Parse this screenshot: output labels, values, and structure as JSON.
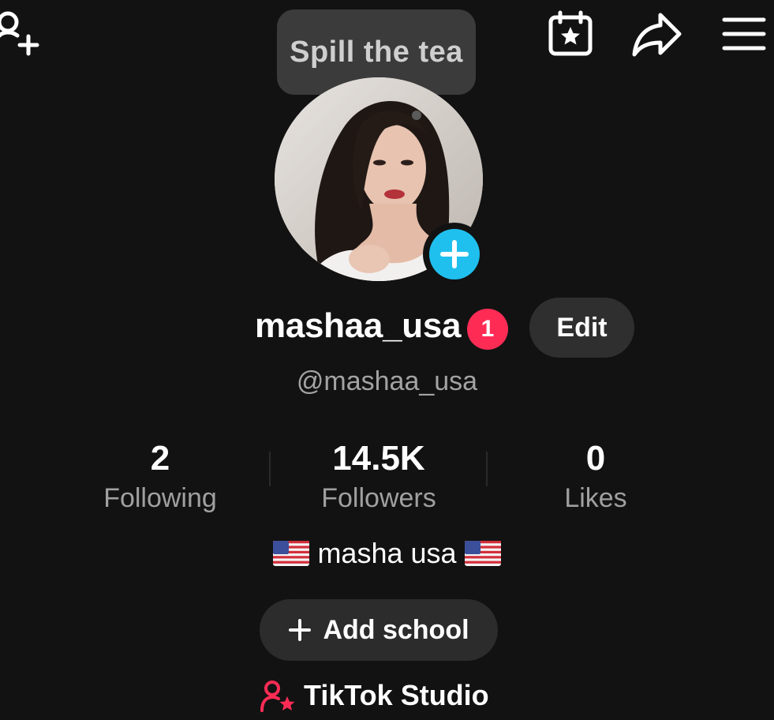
{
  "tooltip": {
    "text": "Spill the tea"
  },
  "profile": {
    "username": "mashaa_usa",
    "notification_count": "1",
    "handle": "@mashaa_usa",
    "edit_label": "Edit",
    "bio": "masha usa"
  },
  "stats": [
    {
      "value": "2",
      "label": "Following"
    },
    {
      "value": "14.5K",
      "label": "Followers"
    },
    {
      "value": "0",
      "label": "Likes"
    }
  ],
  "actions": {
    "add_school_label": "Add school",
    "studio_label": "TikTok Studio"
  },
  "icons": {
    "add_friend": "add-friend-icon",
    "calendar": "calendar-star-icon",
    "share": "share-arrow-icon",
    "menu": "hamburger-menu-icon",
    "avatar_add": "plus-icon",
    "studio": "creator-studio-icon",
    "flag": "us-flag-icon"
  },
  "colors": {
    "background": "#121212",
    "badge": "#fe2c55",
    "avatar_add": "#20c0ee",
    "studio_icon": "#fe2c55"
  }
}
